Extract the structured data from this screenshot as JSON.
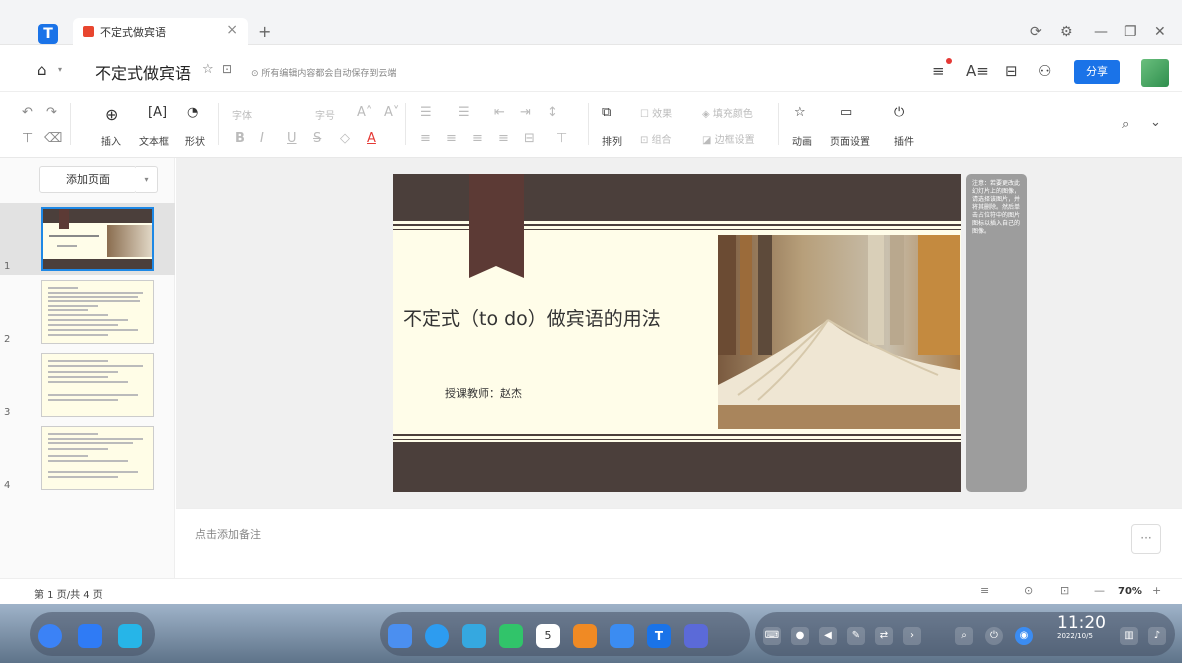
{
  "browser": {
    "tab_title": "不定式做宾语",
    "tab_close": "×",
    "new_tab": "+"
  },
  "header": {
    "doc_title": "不定式做宾语",
    "save_status": "所有编辑内容都会自动保存到云端",
    "share_label": "分享"
  },
  "toolbar": {
    "insert": "插入",
    "textbox": "文本框",
    "shape": "形状",
    "font": "字体",
    "font_size": "字号",
    "bold": "B",
    "italic": "I",
    "underline": "U",
    "strike": "S",
    "arrange": "排列",
    "effect": "效果",
    "group": "组合",
    "fill_color": "填充颜色",
    "border_setting": "边框设置",
    "animation": "动画",
    "page_setting": "页面设置",
    "plugin": "插件"
  },
  "panel": {
    "add_page": "添加页面",
    "slides": [
      "1",
      "2",
      "3",
      "4"
    ]
  },
  "slide": {
    "title": "不定式（to do）做宾语的用法",
    "teacher": "授课教师：赵杰",
    "note_text": "注意：若要更改此幻灯片上的图像，请选择该图片，并将其删除。然后单击占位符中的图片图标以插入自己的图像。"
  },
  "notes": {
    "placeholder": "点击添加备注",
    "more": "···"
  },
  "status": {
    "page_info": "第 1 页/共 4 页",
    "zoom": "70%"
  },
  "taskbar": {
    "time": "11:20",
    "date": "2022/10/5",
    "calendar_day": "5"
  },
  "colors": {
    "accent": "#1a73e8",
    "slide_dark": "#4b3f3b",
    "slide_bg": "#fffde9"
  }
}
